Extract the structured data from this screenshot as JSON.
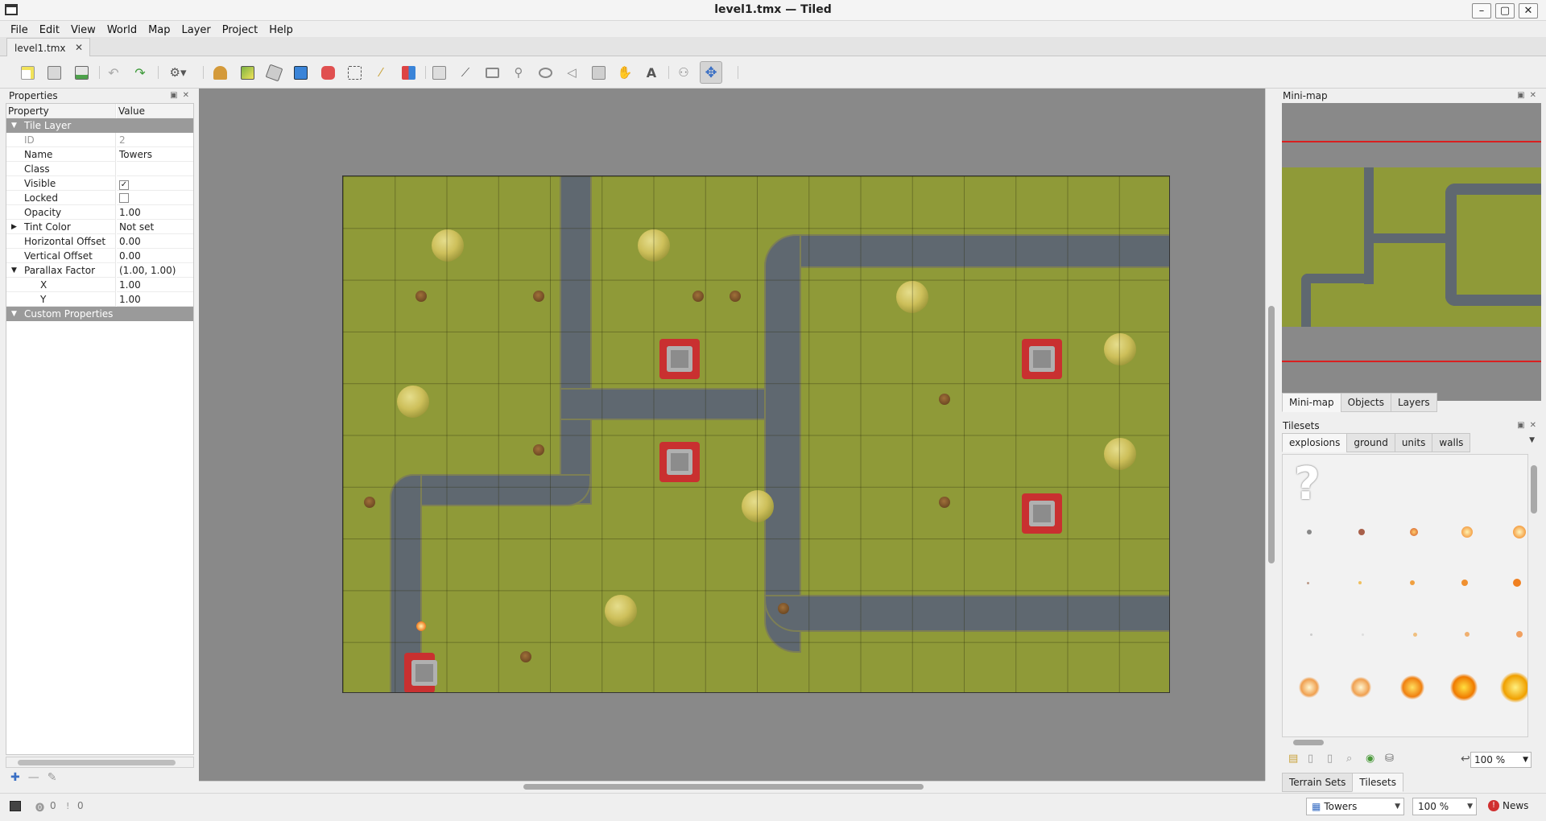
{
  "window": {
    "title": "level1.tmx — Tiled",
    "min": "–",
    "max": "▢",
    "close": "✕"
  },
  "menu": [
    "File",
    "Edit",
    "View",
    "World",
    "Map",
    "Layer",
    "Project",
    "Help"
  ],
  "document_tab": {
    "label": "level1.tmx",
    "close": "✕"
  },
  "toolbar": {
    "icons": [
      "new-map-icon",
      "open-icon",
      "save-icon",
      "undo-icon",
      "redo-icon",
      "command-icon",
      "stamp-brush-icon",
      "terrain-brush-icon",
      "bucket-fill-icon",
      "shape-fill-icon",
      "eraser-icon",
      "rect-select-icon",
      "magic-wand-icon",
      "select-same-tile-icon",
      "select-objects-icon",
      "edit-polygons-icon",
      "insert-rectangle-icon",
      "insert-point-icon",
      "insert-ellipse-icon",
      "insert-polygon-icon",
      "insert-tile-icon",
      "insert-template-icon",
      "insert-text-icon",
      "world-tool-icon",
      "move-tool-icon"
    ]
  },
  "properties": {
    "title": "Properties",
    "col_property": "Property",
    "col_value": "Value",
    "group_tile_layer": "Tile Layer",
    "id_label": "ID",
    "id_value": "2",
    "name_label": "Name",
    "name_value": "Towers",
    "class_label": "Class",
    "class_value": "",
    "visible_label": "Visible",
    "visible_value": true,
    "locked_label": "Locked",
    "locked_value": false,
    "opacity_label": "Opacity",
    "opacity_value": "1.00",
    "tint_label": "Tint Color",
    "tint_value": "Not set",
    "hoffset_label": "Horizontal Offset",
    "hoffset_value": "0.00",
    "voffset_label": "Vertical Offset",
    "voffset_value": "0.00",
    "parallax_label": "Parallax Factor",
    "parallax_value": "(1.00, 1.00)",
    "x_label": "X",
    "x_value": "1.00",
    "y_label": "Y",
    "y_value": "1.00",
    "group_custom": "Custom Properties",
    "check": "✓"
  },
  "minimap": {
    "title": "Mini-map",
    "tabs": [
      "Mini-map",
      "Objects",
      "Layers"
    ]
  },
  "tilesets": {
    "title": "Tilesets",
    "tabs": [
      "explosions",
      "ground",
      "units",
      "walls"
    ],
    "unknown_glyph": "?",
    "zoom": "100 %"
  },
  "bottom_tabs": [
    "Terrain Sets",
    "Tilesets"
  ],
  "status": {
    "errors": "0",
    "warnings": "0",
    "layer": "Towers",
    "zoom": "100 %",
    "news": "News"
  },
  "colors": {
    "grass": "#8f9a38",
    "road": "#5f6870",
    "accent": "#3a6fc4",
    "news": "#d03030"
  }
}
